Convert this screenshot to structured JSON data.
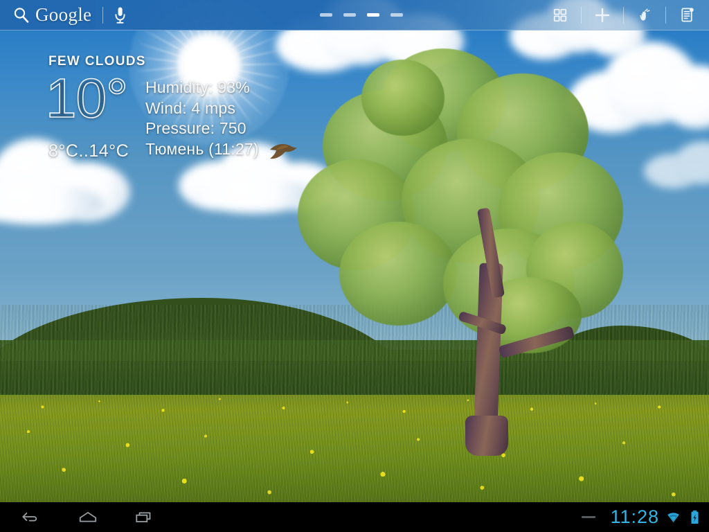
{
  "topbar": {
    "search_icon": "search-icon",
    "brand": "Google",
    "mic_icon": "microphone-icon",
    "page_indicator": {
      "total": 4,
      "active_index": 2
    },
    "actions": [
      {
        "name": "app-drawer-icon",
        "label": "Apps"
      },
      {
        "name": "add-widget-icon",
        "label": "Add"
      },
      {
        "name": "customize-hand-icon",
        "label": "Customize"
      },
      {
        "name": "notes-list-icon",
        "label": "Notes"
      }
    ]
  },
  "weather_widget": {
    "condition": "FEW CLOUDS",
    "temperature": "10°",
    "range": "8°C..14°C",
    "humidity": "Humidity: 93%",
    "wind": "Wind: 4 mps",
    "pressure": "Pressure: 750",
    "location": "Тюмень (11:27)"
  },
  "navbar": {
    "back_icon": "back-arrow-icon",
    "home_icon": "home-icon",
    "recents_icon": "recent-apps-icon",
    "clock": "11:28",
    "wifi_icon": "wifi-icon",
    "battery_icon": "battery-charging-icon",
    "accent_color": "#34b4e4"
  },
  "wallpaper": {
    "description": "spring-meadow-tree-live-wallpaper",
    "sky_color": "#2478c2",
    "meadow_color": "#7d9520",
    "forest_color": "#33501c",
    "trunk_color": "#6b4c54"
  }
}
